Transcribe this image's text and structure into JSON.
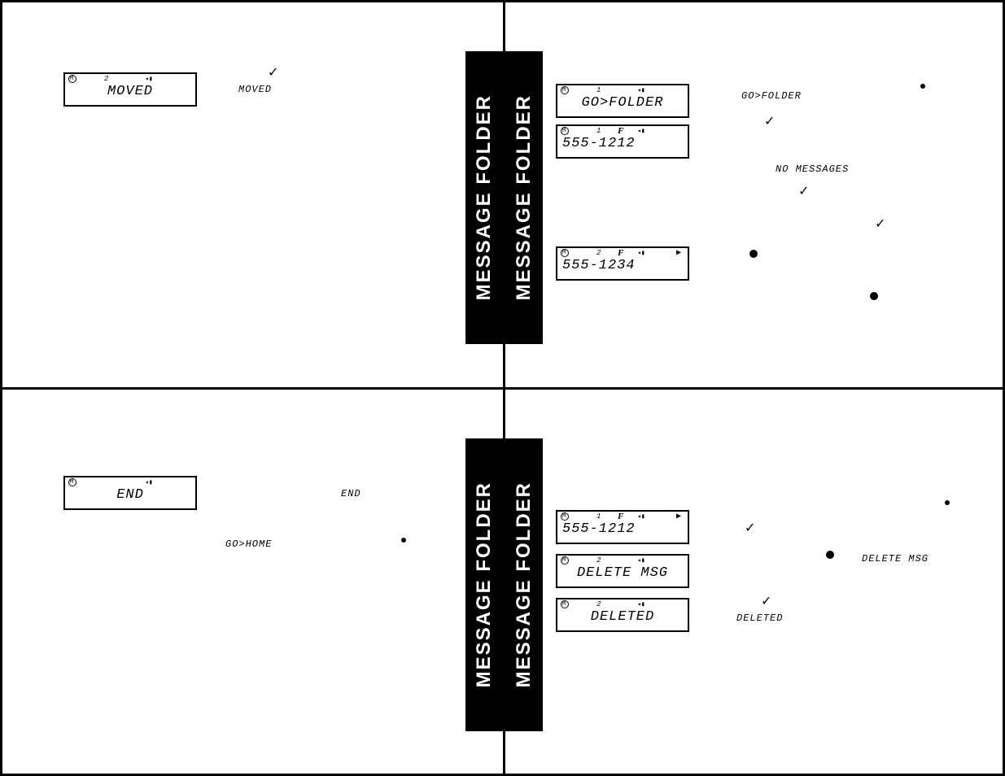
{
  "tab_label": "MESSAGE FOLDER",
  "q1": {
    "lcd_moved": {
      "num": "2",
      "main": "MOVED"
    },
    "cap_moved": "MOVED"
  },
  "q2": {
    "lcd_gofolder": {
      "num": "1",
      "main": "GO>FOLDER"
    },
    "lcd_5551212": {
      "num": "1",
      "f": "F",
      "main": "555-1212"
    },
    "lcd_5551234": {
      "num": "2",
      "f": "F",
      "main": "555-1234"
    },
    "cap_gofolder": "GO>FOLDER",
    "cap_nomessages": "NO MESSAGES"
  },
  "q3": {
    "lcd_end": {
      "main": "END"
    },
    "cap_end": "END",
    "cap_gohome": "GO>HOME"
  },
  "q4": {
    "lcd_5551212": {
      "num": "1",
      "f": "F",
      "main": "555-1212"
    },
    "lcd_deletemsg": {
      "num": "2",
      "main": "DELETE MSG"
    },
    "lcd_deleted": {
      "num": "2",
      "main": "DELETED"
    },
    "cap_deletemsg": "DELETE MSG",
    "cap_deleted": "DELETED"
  }
}
